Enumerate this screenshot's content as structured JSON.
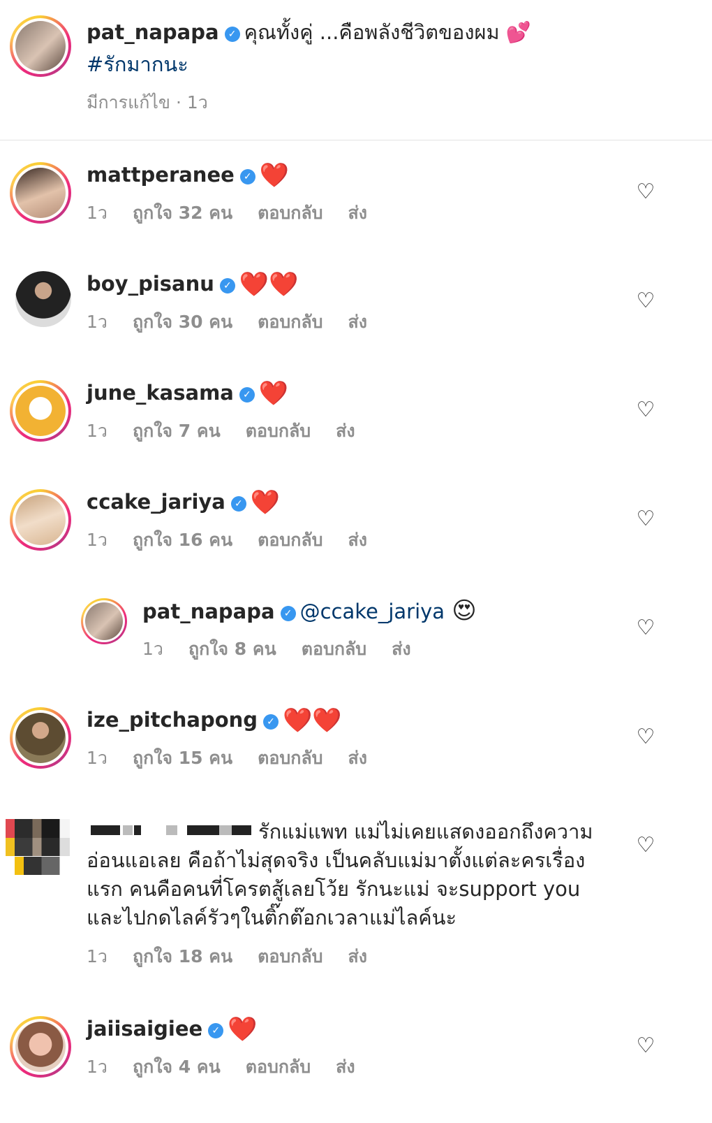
{
  "caption": {
    "username": "pat_napapa",
    "text": "คุณทั้งคู่ ...คือพลังชีวิตของผม 💕",
    "hashtag": "#รักมากนะ",
    "meta": "มีการแก้ไข · 1ว"
  },
  "comments": [
    {
      "username": "mattperanee",
      "text": "❤️",
      "time": "1ว",
      "likes": "ถูกใจ 32 คน",
      "reply": "ตอบกลับ",
      "send": "ส่ง"
    },
    {
      "username": "boy_pisanu",
      "text": "❤️❤️",
      "time": "1ว",
      "likes": "ถูกใจ 30 คน",
      "reply": "ตอบกลับ",
      "send": "ส่ง"
    },
    {
      "username": "june_kasama",
      "text": "❤️",
      "time": "1ว",
      "likes": "ถูกใจ 7 คน",
      "reply": "ตอบกลับ",
      "send": "ส่ง"
    },
    {
      "username": "ccake_jariya",
      "text": "❤️",
      "time": "1ว",
      "likes": "ถูกใจ 16 คน",
      "reply": "ตอบกลับ",
      "send": "ส่ง"
    },
    {
      "username": "pat_napapa",
      "mention": "@ccake_jariya",
      "text": "😍",
      "time": "1ว",
      "likes": "ถูกใจ 8 คน",
      "reply": "ตอบกลับ",
      "send": "ส่ง"
    },
    {
      "username": "ize_pitchapong",
      "text": "❤️❤️",
      "time": "1ว",
      "likes": "ถูกใจ 15 คน",
      "reply": "ตอบกลับ",
      "send": "ส่ง"
    },
    {
      "username": "",
      "text": "รักแม่แพท แม่ไม่เคยแสดงออกถึงความอ่อนแอเลย คือถ้าไม่สุดจริง เป็นคลับแม่มาตั้งแต่ละครเรื่องแรก คนคือคนที่โครตสู้เลยโว้ย รักนะแม่ จะsupport you และไปกดไลค์รัวๆในติ๊กต๊อกเวลาแม่ไลค์นะ",
      "time": "1ว",
      "likes": "ถูกใจ 18 คน",
      "reply": "ตอบกลับ",
      "send": "ส่ง"
    },
    {
      "username": "jaiisaigiee",
      "text": "❤️",
      "time": "1ว",
      "likes": "ถูกใจ 4 คน",
      "reply": "ตอบกลับ",
      "send": "ส่ง"
    }
  ],
  "icons": {
    "verified": "verified-badge-icon",
    "like": "heart-outline-icon"
  },
  "colors": {
    "verified": "#3897f0",
    "hashtag": "#00376b",
    "meta": "#8e8e8e",
    "heart": "#ed1c24"
  }
}
